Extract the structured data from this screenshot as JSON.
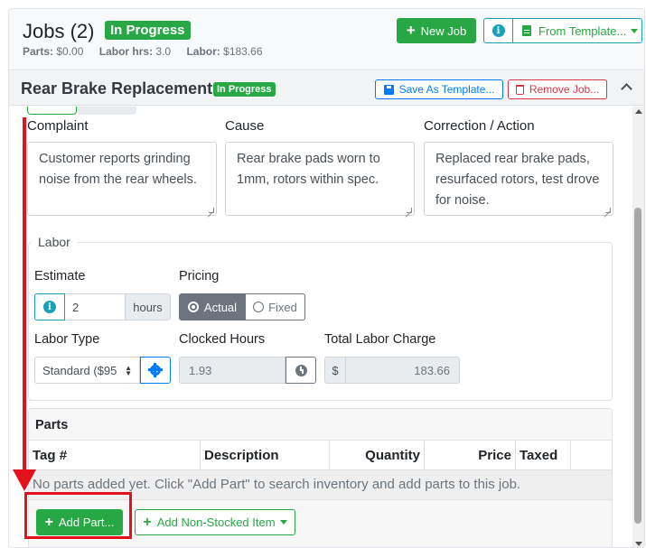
{
  "header": {
    "title": "Jobs (2)",
    "status_badge": "In Progress",
    "stats": [
      {
        "label": "Parts:",
        "value": "$0.00"
      },
      {
        "label": "Labor hrs:",
        "value": "3.0"
      },
      {
        "label": "Labor:",
        "value": "$183.66"
      }
    ],
    "new_job_label": "New Job",
    "from_template_label": "From Template..."
  },
  "job": {
    "title": "Rear Brake Replacement",
    "status_badge": "In Progress",
    "save_template_label": "Save As Template...",
    "remove_job_label": "Remove Job..."
  },
  "fields": {
    "complaint_label": "Complaint",
    "complaint_value": "Customer reports grinding noise from the rear wheels.",
    "cause_label": "Cause",
    "cause_value": "Rear brake pads worn to 1mm, rotors within spec.",
    "correction_label": "Correction / Action",
    "correction_value": "Replaced rear brake pads, resurfaced rotors, test drove for noise."
  },
  "labor": {
    "legend": "Labor",
    "estimate_label": "Estimate",
    "estimate_value": "2",
    "estimate_unit": "hours",
    "pricing_label": "Pricing",
    "pricing_options": [
      "Actual",
      "Fixed"
    ],
    "pricing_selected": "Actual",
    "labor_type_label": "Labor Type",
    "labor_type_value": "Standard ($95",
    "clocked_hours_label": "Clocked Hours",
    "clocked_hours_value": "1.93",
    "total_charge_label": "Total Labor Charge",
    "currency_symbol": "$",
    "total_charge_value": "183.66"
  },
  "parts": {
    "title": "Parts",
    "columns": [
      "Tag #",
      "Description",
      "Quantity",
      "Price",
      "Taxed"
    ],
    "empty_message": "No parts added yet. Click \"Add Part\" to search inventory and add parts to this job.",
    "add_part_label": "Add Part...",
    "add_nonstocked_label": "Add Non-Stocked Item"
  },
  "colors": {
    "success": "#28a745",
    "primary": "#007bff",
    "danger": "#dc3545",
    "info": "#17a2b8",
    "annotation_red": "#e3111b"
  },
  "icons": [
    "plus-icon",
    "info-icon",
    "document-icon",
    "save-icon",
    "trash-icon",
    "chevron-up-icon",
    "gear-icon",
    "clock-icon",
    "radio-icon",
    "caret-down-icon"
  ]
}
